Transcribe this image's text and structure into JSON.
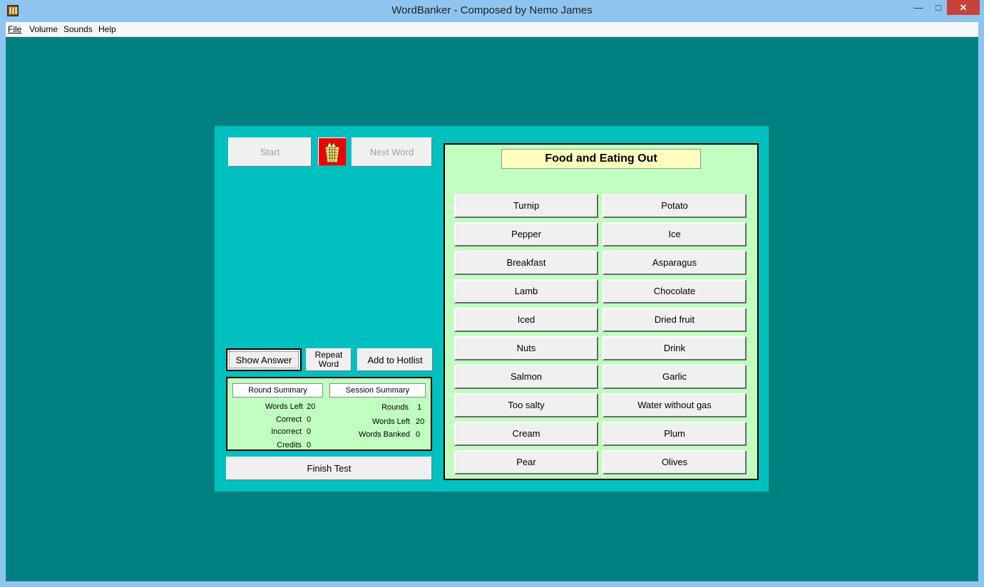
{
  "window": {
    "title": "WordBanker - Composed by Nemo James",
    "minimize": "—",
    "maximize": "□",
    "close": "✕"
  },
  "menu": {
    "file": "File",
    "volume": "Volume",
    "sounds": "Sounds",
    "help": "Help"
  },
  "controls": {
    "start": "Start",
    "next_word": "Next Word",
    "show_answer": "Show Answer",
    "repeat_word": "Repeat Word",
    "add_to_hotlist": "Add to  Hotlist",
    "finish_test": "Finish Test"
  },
  "round_summary": {
    "header": "Round Summary",
    "words_left_label": "Words Left",
    "words_left": "20",
    "correct_label": "Correct",
    "correct": "0",
    "incorrect_label": "Incorrect",
    "incorrect": "0",
    "credits_label": "Credits",
    "credits": "0"
  },
  "session_summary": {
    "header": "Session Summary",
    "rounds_label": "Rounds",
    "rounds": "1",
    "words_left_label": "Words Left",
    "words_left": "20",
    "words_banked_label": "Words Banked",
    "words_banked": "0"
  },
  "category": "Food and Eating Out",
  "words": [
    "Turnip",
    "Potato",
    "Pepper",
    "Ice",
    "Breakfast",
    "Asparagus",
    "Lamb",
    "Chocolate",
    "Iced",
    "Dried fruit",
    "Nuts",
    "Drink",
    "Salmon",
    "Garlic",
    "Too salty",
    "Water without gas",
    "Cream",
    "Plum",
    "Pear",
    "Olives"
  ],
  "colors": {
    "desktop": "#008080",
    "panel": "#00c0c0",
    "word_area": "#c0ffc0",
    "category_box": "#ffffc0",
    "basket_button": "#ee0000"
  },
  "icons": {
    "app": "app-book-icon",
    "basket": "wastebasket-icon"
  }
}
